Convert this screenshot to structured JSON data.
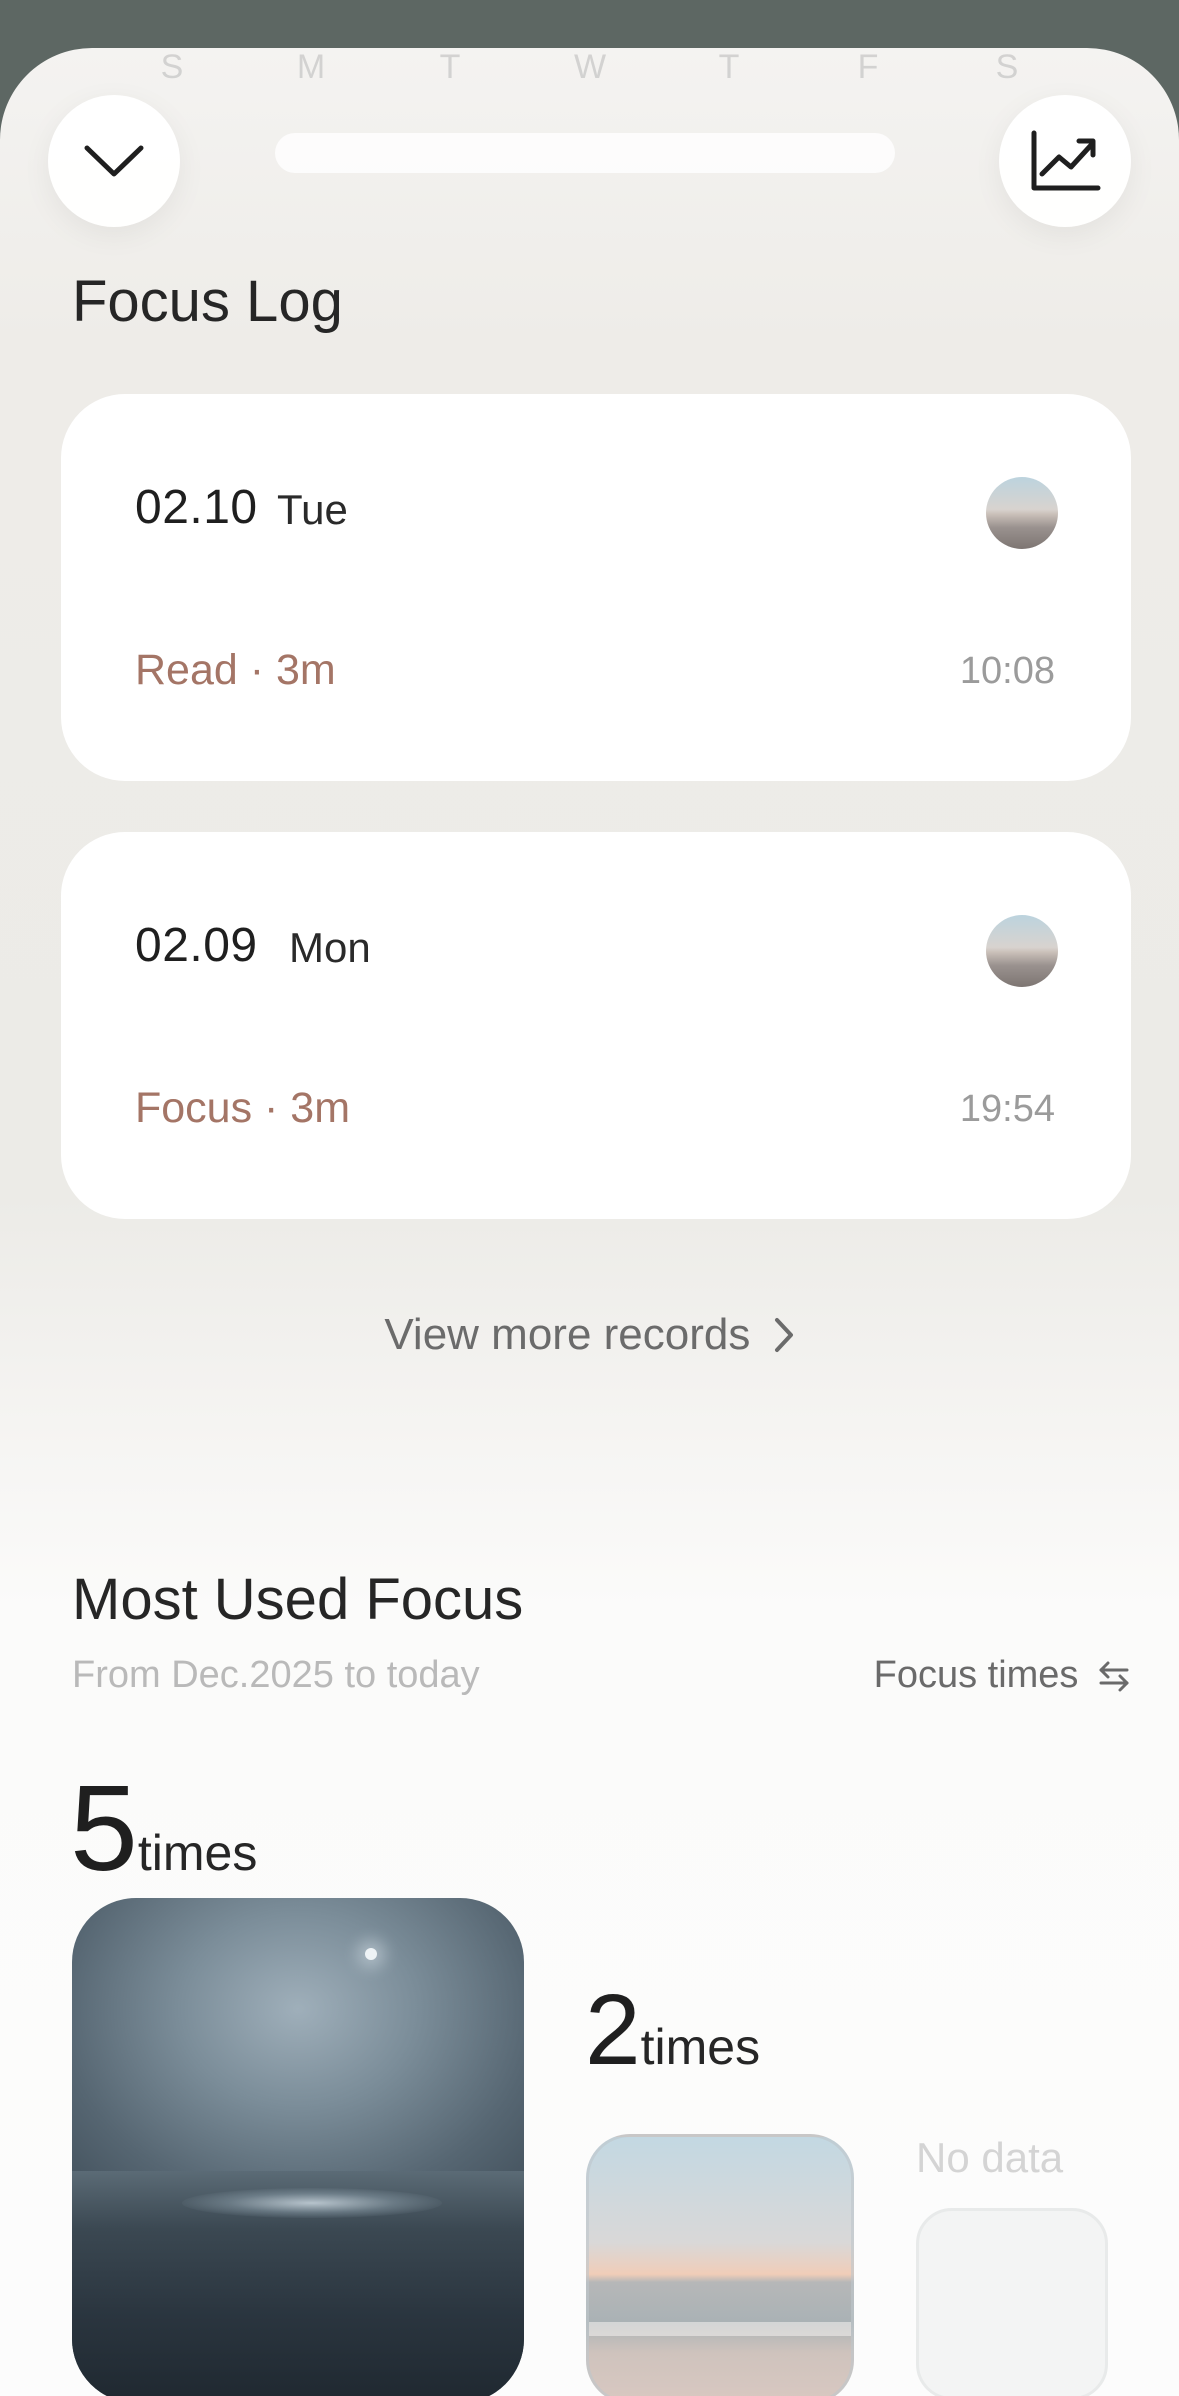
{
  "week_strip": {
    "days": [
      "S",
      "M",
      "T",
      "W",
      "T",
      "F",
      "S"
    ]
  },
  "top_bar": {
    "collapse_icon": "chevron-down-icon",
    "stats_icon": "trend-chart-icon"
  },
  "focus_log": {
    "title": "Focus Log",
    "records": [
      {
        "date": "02.10",
        "weekday": "Tue",
        "activity": "Read · 3m",
        "time": "10:08"
      },
      {
        "date": "02.09",
        "weekday": "Mon",
        "activity": "Focus · 3m",
        "time": "19:54"
      }
    ],
    "view_more": "View more records"
  },
  "most_used": {
    "title": "Most Used Focus",
    "subtitle": "From Dec.2025 to today",
    "metric_switch": "Focus times",
    "items": [
      {
        "count": "5",
        "unit": "times",
        "scene": "night-sea"
      },
      {
        "count": "2",
        "unit": "times",
        "scene": "beach"
      },
      {
        "empty_label": "No data"
      }
    ]
  },
  "colors": {
    "accent": "#a47566",
    "background_top": "#5d6763",
    "card": "#ffffff"
  }
}
